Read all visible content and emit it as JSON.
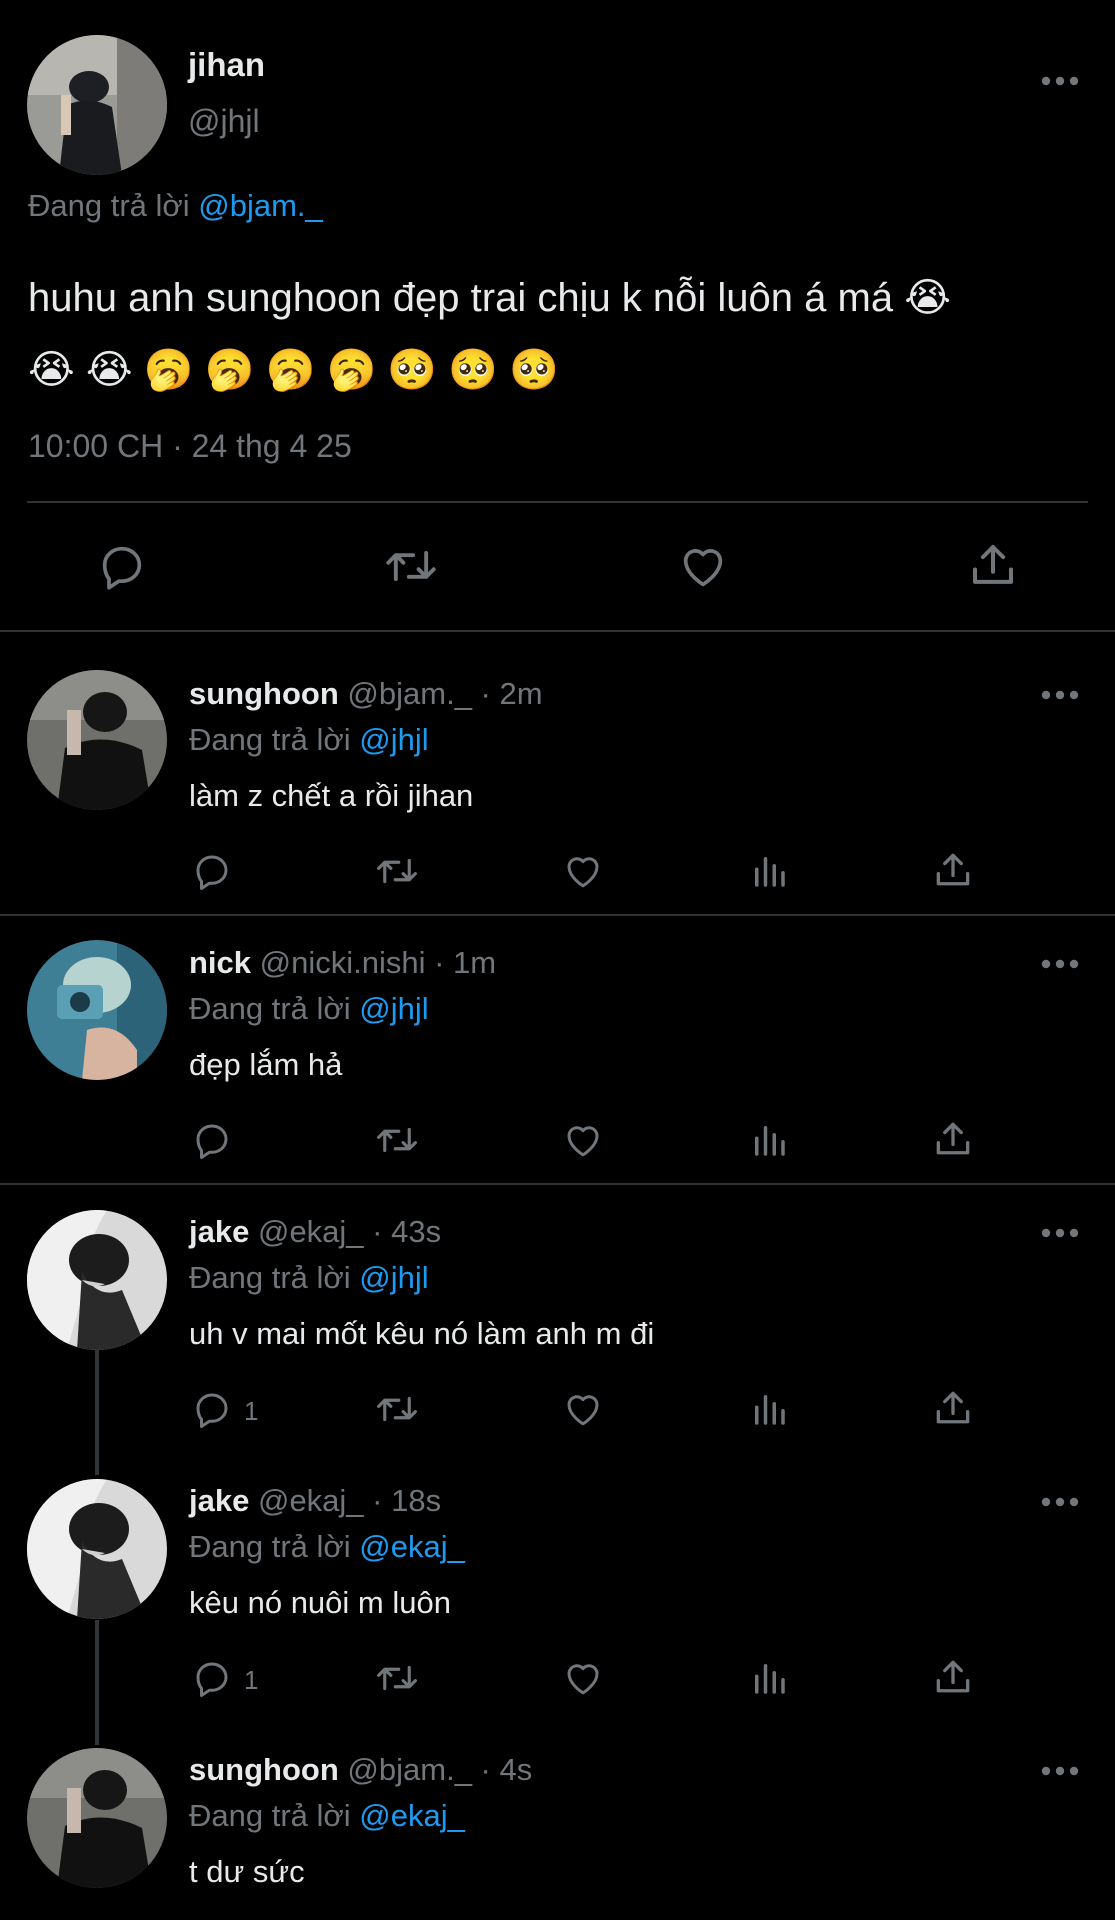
{
  "main_tweet": {
    "name": "jihan",
    "handle": "@jhjl",
    "replying_prefix": "Đang trả lời",
    "replying_to": "@bjam._",
    "text_line1": "huhu anh sunghoon đẹp trai chịu k nỗi luôn á má 😭",
    "text_line2": "😭 😭 🥱 🥱 🥱 🥱 🥺 🥺 🥺",
    "timestamp": "10:00 CH · 24 thg 4 25",
    "actions": [
      "reply-icon",
      "retweet-icon",
      "like-icon",
      "share-icon"
    ]
  },
  "replies": [
    {
      "name": "sunghoon",
      "meta": "@bjam._ · 2m",
      "replying_prefix": "Đang trả lời",
      "replying_to": "@jhjl",
      "text": "làm z chết a rồi jihan",
      "reply_count": ""
    },
    {
      "name": "nick",
      "meta": "@nicki.nishi · 1m",
      "replying_prefix": "Đang trả lời",
      "replying_to": "@jhjl",
      "text": "đẹp lắm hả",
      "reply_count": ""
    },
    {
      "name": "jake",
      "meta": "@ekaj_ · 43s",
      "replying_prefix": "Đang trả lời",
      "replying_to": "@jhjl",
      "text": "uh v mai mốt kêu nó làm anh m đi",
      "reply_count": "1"
    },
    {
      "name": "jake",
      "meta": "@ekaj_ · 18s",
      "replying_prefix": "Đang trả lời",
      "replying_to": "@ekaj_",
      "text": "kêu nó nuôi m luôn",
      "reply_count": "1"
    },
    {
      "name": "sunghoon",
      "meta": "@bjam._ · 4s",
      "replying_prefix": "Đang trả lời",
      "replying_to": "@ekaj_",
      "text": "t dư sức",
      "reply_count": ""
    }
  ],
  "colors": {
    "background": "#000000",
    "text": "#e7e9ea",
    "muted": "#71767b",
    "link": "#1d9bf0",
    "divider": "#2f3336"
  }
}
